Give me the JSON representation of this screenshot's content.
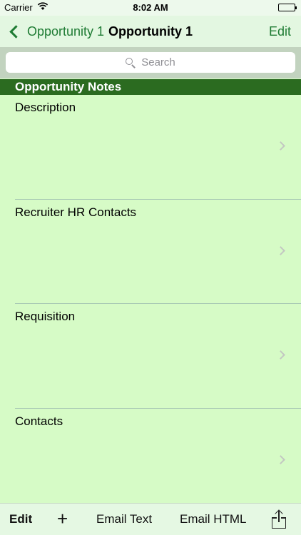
{
  "status_bar": {
    "carrier": "Carrier",
    "time": "8:02 AM"
  },
  "nav": {
    "back_label": "Opportunity 1",
    "title": "Opportunity 1",
    "edit_label": "Edit"
  },
  "search": {
    "placeholder": "Search"
  },
  "section": {
    "title": "Opportunity Notes"
  },
  "rows": [
    {
      "label": "Description"
    },
    {
      "label": "Recruiter HR Contacts"
    },
    {
      "label": "Requisition"
    },
    {
      "label": "Contacts"
    }
  ],
  "toolbar": {
    "edit_label": "Edit",
    "add_icon": "plus-icon",
    "email_text_label": "Email Text",
    "email_html_label": "Email HTML",
    "share_icon": "share-icon"
  },
  "colors": {
    "accent": "#1e7b33",
    "background": "#d6fbc6",
    "section_header": "#2b6b20"
  }
}
